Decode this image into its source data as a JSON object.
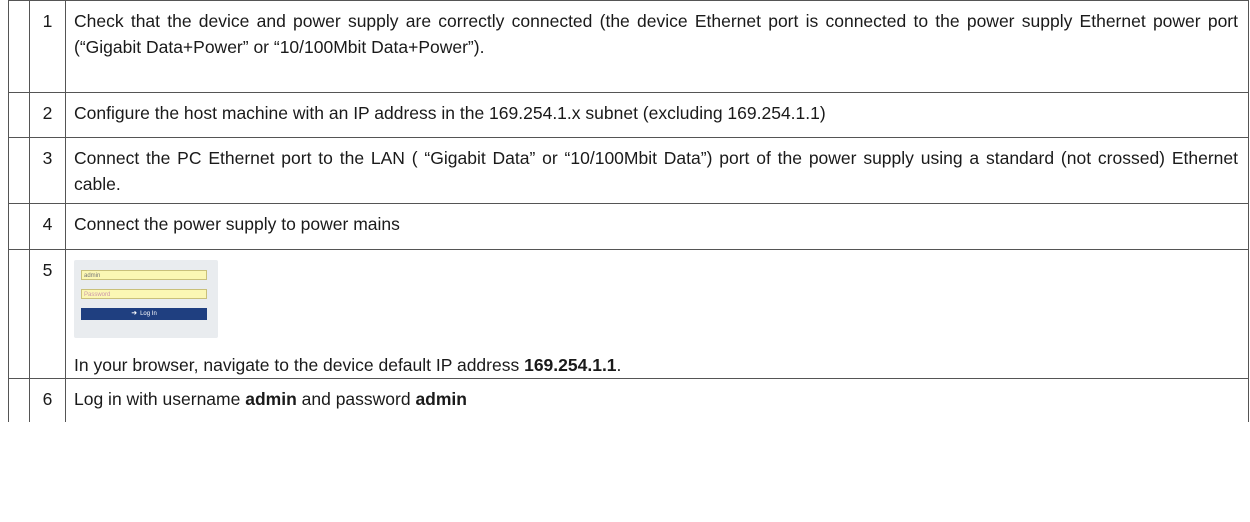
{
  "steps": [
    {
      "number": "1",
      "text": "Check that the device and power supply are correctly connected (the device Ethernet port is connected to the power supply Ethernet power port (“Gigabit Data+Power” or “10/100Mbit Data+Power”)."
    },
    {
      "number": "2",
      "text": "Configure the host machine with an IP address in the 169.254.1.x subnet (excluding 169.254.1.1)"
    },
    {
      "number": "3",
      "text": "Connect the PC Ethernet port to the LAN ( “Gigabit Data” or  “10/100Mbit Data”) port of the power supply using a standard (not crossed) Ethernet cable."
    },
    {
      "number": "4",
      "text": "Connect the power supply to power mains"
    },
    {
      "number": "5",
      "login_form": {
        "username_value": "admin",
        "password_placeholder": "Password",
        "button_label": "Log In"
      },
      "text_before": "In your browser, navigate to the device default IP address ",
      "ip_address": "169.254.1.1",
      "text_after": "."
    },
    {
      "number": "6",
      "text_before": "Log in with username ",
      "username": "admin",
      "text_middle": " and password ",
      "password": "admin"
    }
  ]
}
